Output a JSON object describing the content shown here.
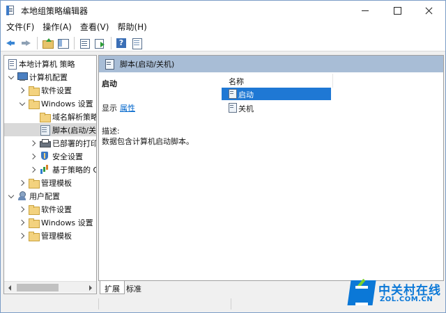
{
  "window": {
    "title": "本地组策略编辑器",
    "controls": {
      "minimize": "minimize",
      "maximize": "maximize",
      "close": "close"
    }
  },
  "menu": {
    "items": [
      "文件(F)",
      "操作(A)",
      "查看(V)",
      "帮助(H)"
    ]
  },
  "toolbar": {
    "icons": [
      "back-arrow-icon",
      "forward-arrow-icon",
      "folder-up-icon",
      "show-hide-tree-icon",
      "list-icon",
      "export-icon",
      "help-icon",
      "properties-icon"
    ]
  },
  "tree": {
    "items": [
      {
        "label": "本地计算机 策略",
        "icon": "policy",
        "level": 0,
        "expander": "none"
      },
      {
        "label": "计算机配置",
        "icon": "computer",
        "level": 1,
        "expander": "open"
      },
      {
        "label": "软件设置",
        "icon": "folder",
        "level": 2,
        "expander": "closed"
      },
      {
        "label": "Windows 设置",
        "icon": "folder",
        "level": 2,
        "expander": "open"
      },
      {
        "label": "域名解析策略",
        "icon": "folder",
        "level": 3,
        "expander": "none"
      },
      {
        "label": "脚本(启动/关机)",
        "icon": "script",
        "level": 3,
        "expander": "none",
        "selected": true
      },
      {
        "label": "已部署的打印机",
        "icon": "printer",
        "level": 3,
        "expander": "closed"
      },
      {
        "label": "安全设置",
        "icon": "shield",
        "level": 3,
        "expander": "closed"
      },
      {
        "label": "基于策略的 QoS",
        "icon": "chart",
        "level": 3,
        "expander": "closed"
      },
      {
        "label": "管理模板",
        "icon": "folder",
        "level": 2,
        "expander": "closed"
      },
      {
        "label": "用户配置",
        "icon": "user",
        "level": 1,
        "expander": "open"
      },
      {
        "label": "软件设置",
        "icon": "folder",
        "level": 2,
        "expander": "closed"
      },
      {
        "label": "Windows 设置",
        "icon": "folder",
        "level": 2,
        "expander": "closed"
      },
      {
        "label": "管理模板",
        "icon": "folder",
        "level": 2,
        "expander": "closed"
      }
    ]
  },
  "detail": {
    "header_title": "脚本(启动/关机)",
    "section_title": "启动",
    "show_label": "显示",
    "show_link": "属性",
    "desc_label": "描述:",
    "desc_text": "数据包含计算机启动脚本。",
    "column_name": "名称",
    "list": [
      {
        "label": "启动",
        "selected": true
      },
      {
        "label": "关机",
        "selected": false
      }
    ]
  },
  "tabs": [
    {
      "label": "扩展",
      "active": true
    },
    {
      "label": "标准",
      "active": false
    }
  ],
  "watermark": {
    "title": "中关村在线",
    "subtitle": "ZOL.COM.CN"
  }
}
